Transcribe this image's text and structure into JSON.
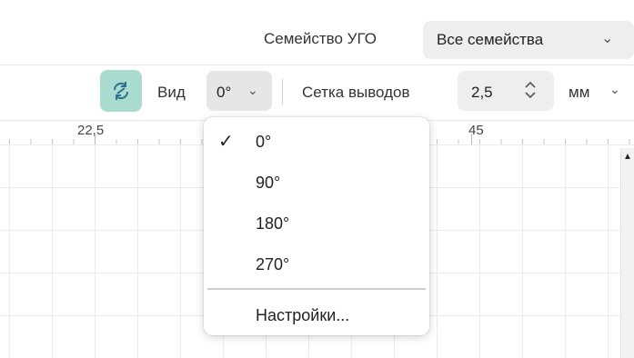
{
  "header": {
    "family_label": "Семейство УГО",
    "family_value": "Все семейства"
  },
  "toolbar": {
    "rotate_icon": "rotate-arrows-icon",
    "view_label": "Вид",
    "view_value": "0°",
    "grid_label": "Сетка выводов",
    "grid_value": "2,5",
    "unit_value": "мм"
  },
  "ruler": {
    "labels": [
      "22,5",
      "45"
    ]
  },
  "view_menu": {
    "options": [
      "0°",
      "90°",
      "180°",
      "270°"
    ],
    "selected": "0°",
    "settings_label": "Настройки..."
  },
  "colors": {
    "accent": "#a9dccf",
    "select_bg": "#eeeeee"
  }
}
